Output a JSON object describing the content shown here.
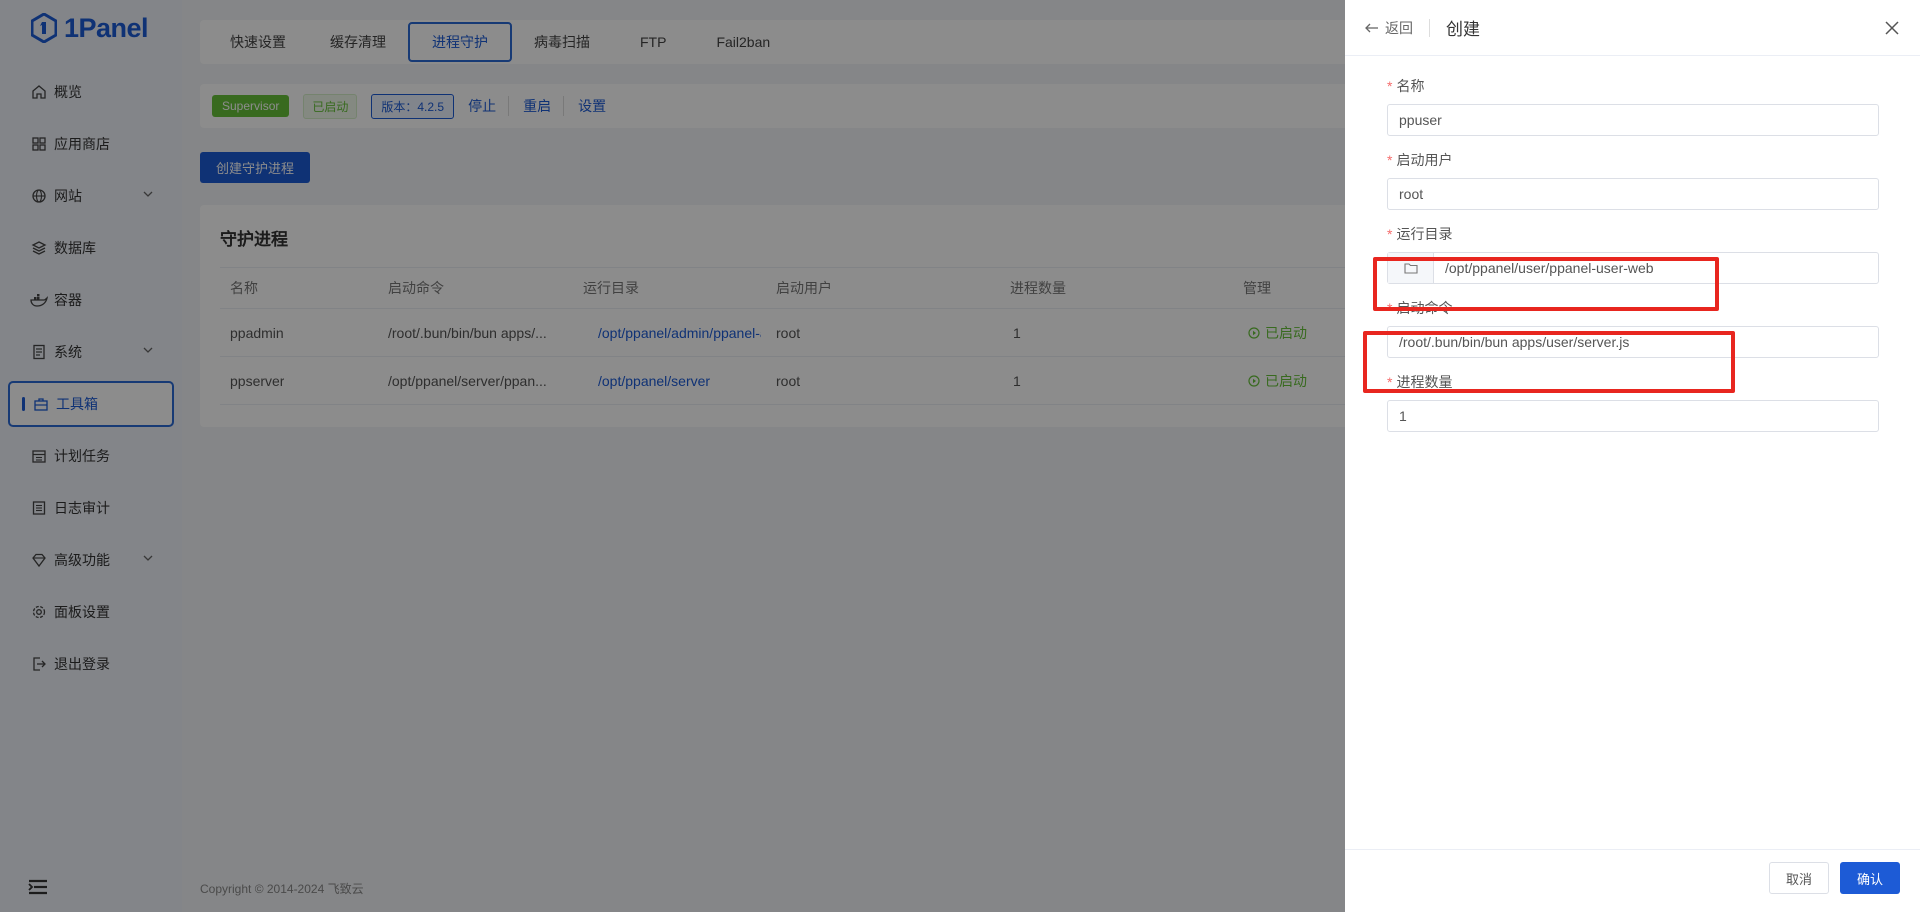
{
  "app": {
    "logo": "1Panel"
  },
  "sidebar": {
    "items": [
      {
        "label": "概览",
        "icon": "home-icon"
      },
      {
        "label": "应用商店",
        "icon": "grid-icon"
      },
      {
        "label": "网站",
        "icon": "globe-icon"
      },
      {
        "label": "数据库",
        "icon": "layers-icon"
      },
      {
        "label": "容器",
        "icon": "docker-icon"
      },
      {
        "label": "系统",
        "icon": "server-icon"
      },
      {
        "label": "工具箱",
        "icon": "toolbox-icon"
      },
      {
        "label": "计划任务",
        "icon": "calendar-icon"
      },
      {
        "label": "日志审计",
        "icon": "log-icon"
      },
      {
        "label": "高级功能",
        "icon": "diamond-icon"
      },
      {
        "label": "面板设置",
        "icon": "gear-icon"
      },
      {
        "label": "退出登录",
        "icon": "logout-icon"
      }
    ]
  },
  "tabs": [
    "快速设置",
    "缓存清理",
    "进程守护",
    "病毒扫描",
    "FTP",
    "Fail2ban"
  ],
  "status_bar": {
    "service": "Supervisor",
    "state": "已启动",
    "version": "版本：4.2.5",
    "stop": "停止",
    "restart": "重启",
    "settings": "设置"
  },
  "create_button": "创建守护进程",
  "card": {
    "title": "守护进程",
    "columns": [
      "名称",
      "启动命令",
      "运行目录",
      "启动用户",
      "进程数量",
      "管理"
    ],
    "rows": [
      {
        "name": "ppadmin",
        "command": "/root/.bun/bin/bun apps/...",
        "dir": "/opt/ppanel/admin/ppanel-a",
        "user": "root",
        "count": "1",
        "status": "已启动"
      },
      {
        "name": "ppserver",
        "command": "/opt/ppanel/server/ppan...",
        "dir": "/opt/ppanel/server",
        "user": "root",
        "count": "1",
        "status": "已启动"
      }
    ]
  },
  "footer": {
    "copyright": "Copyright © 2014-2024 飞致云"
  },
  "drawer": {
    "back": "返回",
    "title": "创建",
    "fields": {
      "name": {
        "label": "名称",
        "value": "ppuser"
      },
      "user": {
        "label": "启动用户",
        "value": "root"
      },
      "dir": {
        "label": "运行目录",
        "value": "/opt/ppanel/user/ppanel-user-web"
      },
      "command": {
        "label": "启动命令",
        "value": "/root/.bun/bin/bun apps/user/server.js"
      },
      "count": {
        "label": "进程数量",
        "value": "1"
      }
    },
    "cancel": "取消",
    "confirm": "确认"
  },
  "colors": {
    "accent": "#1d5bd6",
    "success": "#67c23a",
    "highlight": "#e8261f"
  }
}
